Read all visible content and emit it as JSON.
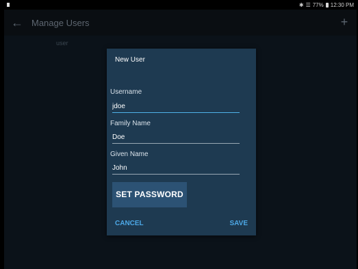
{
  "status_bar": {
    "battery_percent": "77%",
    "time": "12:30 PM",
    "bluetooth_icon": "bluetooth-icon",
    "wifi_icon": "wifi-icon",
    "battery_icon": "battery-icon"
  },
  "app_bar": {
    "title": "Manage Users",
    "back_icon": "arrow-left-icon",
    "add_icon": "plus-icon"
  },
  "list": {
    "header": "user"
  },
  "dialog": {
    "title": "New User",
    "fields": [
      {
        "label": "Username",
        "value": "jdoe",
        "focused": true
      },
      {
        "label": "Family Name",
        "value": "Doe",
        "focused": false
      },
      {
        "label": "Given Name",
        "value": "John",
        "focused": false
      }
    ],
    "set_password_label": "SET PASSWORD",
    "cancel_label": "CANCEL",
    "save_label": "SAVE"
  },
  "colors": {
    "background": "#000000",
    "app_bar": "#0a0e12",
    "dialog": "#1e3a51",
    "accent": "#4da8e6",
    "button": "#2c5274"
  }
}
